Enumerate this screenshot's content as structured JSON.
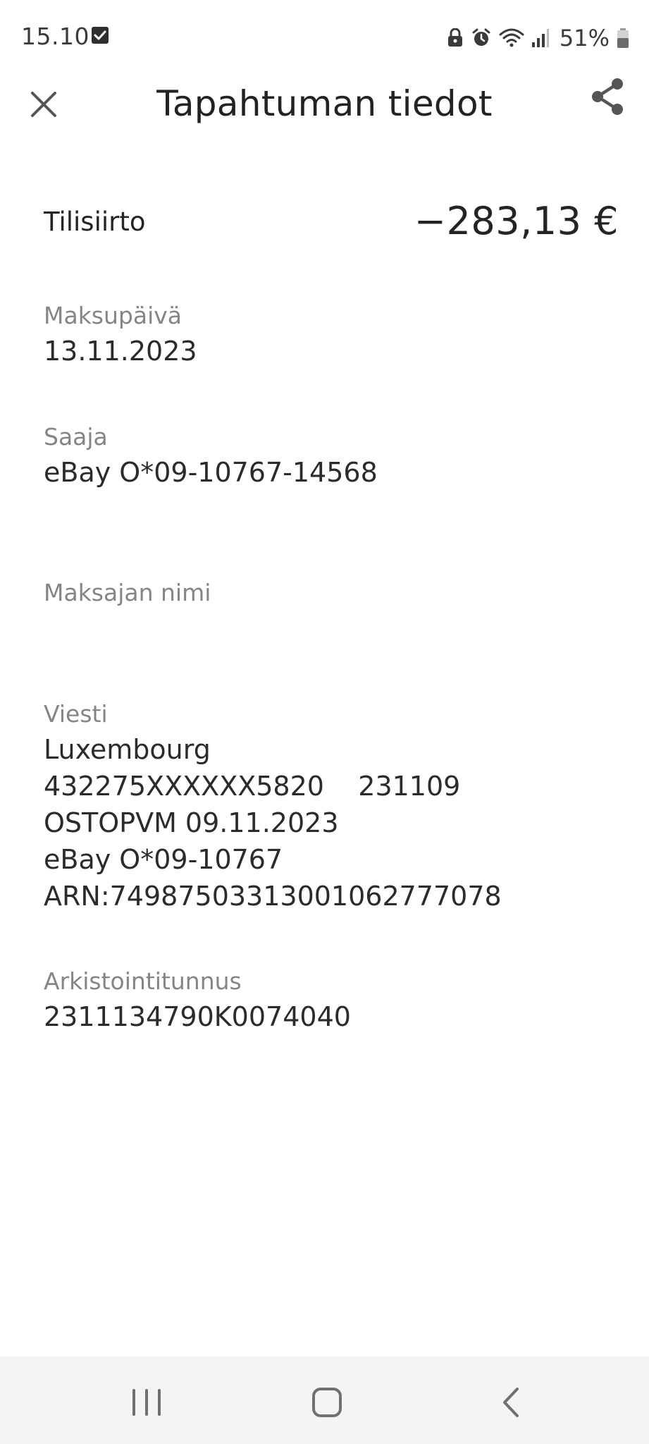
{
  "status_bar": {
    "time": "15.10",
    "battery": "51%",
    "icons": [
      "checkbox-notification-icon",
      "lock-icon",
      "alarm-icon",
      "wifi-icon",
      "signal-icon",
      "battery-icon"
    ]
  },
  "header": {
    "title": "Tapahtuman tiedot",
    "close_icon": "close-icon",
    "share_icon": "share-icon"
  },
  "summary": {
    "type": "Tilisiirto",
    "amount": "−283,13 €"
  },
  "fields": {
    "payment_date": {
      "label": "Maksupäivä",
      "value": "13.11.2023"
    },
    "recipient": {
      "label": "Saaja",
      "value": "eBay O*09-10767-14568"
    },
    "payer_name": {
      "label": "Maksajan nimi",
      "value": ""
    },
    "message": {
      "label": "Viesti",
      "lines": [
        "Luxembourg",
        "432275XXXXXX5820    231109",
        "OSTOPVM 09.11.2023",
        "eBay O*09-10767",
        "ARN:74987503313001062777078"
      ]
    },
    "archive_id": {
      "label": "Arkistointitunnus",
      "value": "2311134790K0074040"
    }
  },
  "nav_bar": {
    "icons": [
      "recent-apps-icon",
      "home-icon",
      "back-icon"
    ]
  },
  "colors": {
    "background": "#ffffff",
    "text_primary": "#242424",
    "text_secondary": "#858585",
    "nav_background": "#f4f4f4"
  }
}
